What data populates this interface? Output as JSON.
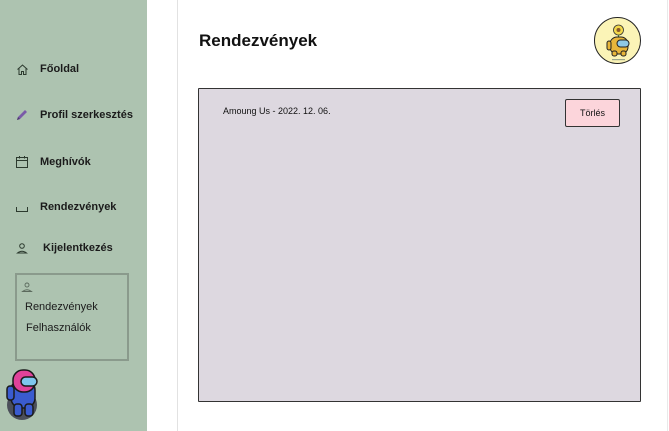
{
  "sidebar": {
    "items": [
      {
        "label": "Főoldal",
        "icon": "home-icon"
      },
      {
        "label": "Profil szerkesztés",
        "icon": "pencil-icon"
      },
      {
        "label": "Meghívók",
        "icon": "calendar-icon"
      },
      {
        "label": "Rendezvények",
        "icon": "tray-icon"
      },
      {
        "label": "Kijelentkezés",
        "icon": "user-icon"
      }
    ],
    "admin": {
      "icon": "user-icon",
      "links": [
        "Rendezvények",
        "Felhasználók"
      ]
    },
    "avatar_icon": "crewmate-icon"
  },
  "header": {
    "title": "Rendezvények",
    "avatar_icon": "crewmate-avatar-icon"
  },
  "events": [
    {
      "text": "Amoung Us -  2022. 12. 06.",
      "delete_label": "Törlés"
    }
  ],
  "colors": {
    "sidebar": "#adc3b0",
    "panel": "#ddd8e0",
    "delete_button": "#fcd5db",
    "avatar_background": "#fbf4b7"
  }
}
